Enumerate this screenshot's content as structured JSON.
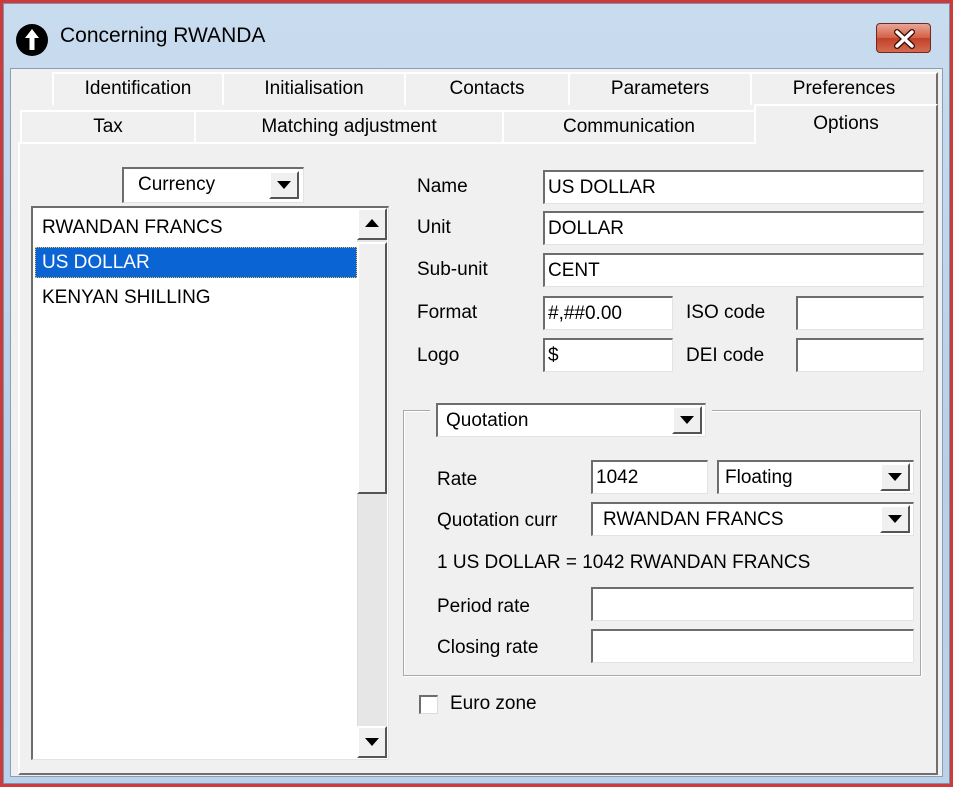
{
  "window": {
    "title": "Concerning RWANDA"
  },
  "tabs": {
    "row_back": [
      "Identification",
      "Initialisation",
      "Contacts",
      "Parameters",
      "Preferences"
    ],
    "row_front": [
      "Tax",
      "Matching adjustment",
      "Communication",
      "Options"
    ],
    "active": "Options"
  },
  "left": {
    "selector_value": "Currency",
    "list_items": [
      "RWANDAN FRANCS",
      "US DOLLAR",
      "KENYAN SHILLING"
    ],
    "selected_item": "US DOLLAR"
  },
  "form": {
    "name_label": "Name",
    "name_value": "US DOLLAR",
    "unit_label": "Unit",
    "unit_value": "DOLLAR",
    "subunit_label": "Sub-unit",
    "subunit_value": "CENT",
    "format_label": "Format",
    "format_value": "#,##0.00",
    "iso_label": "ISO code",
    "iso_value": "",
    "logo_label": "Logo",
    "logo_value": "$",
    "dei_label": "DEI code",
    "dei_value": ""
  },
  "quotation": {
    "group_selector": "Quotation",
    "rate_label": "Rate",
    "rate_value": "1042",
    "rate_type": "Floating",
    "curr_label": "Quotation curr",
    "curr_value": "RWANDAN FRANCS",
    "conversion_text": "1 US DOLLAR = 1042 RWANDAN FRANCS",
    "period_label": "Period rate",
    "period_value": "",
    "closing_label": "Closing rate",
    "closing_value": ""
  },
  "euro_zone": {
    "label": "Euro zone",
    "checked": false
  },
  "colors": {
    "frame": "#cc3a3a",
    "selection": "#0a64d4",
    "close_button": "#c9472f",
    "dialog_bg": "#f0f0f0"
  },
  "icons": {
    "title": "info-circle-icon",
    "close": "close-icon"
  }
}
